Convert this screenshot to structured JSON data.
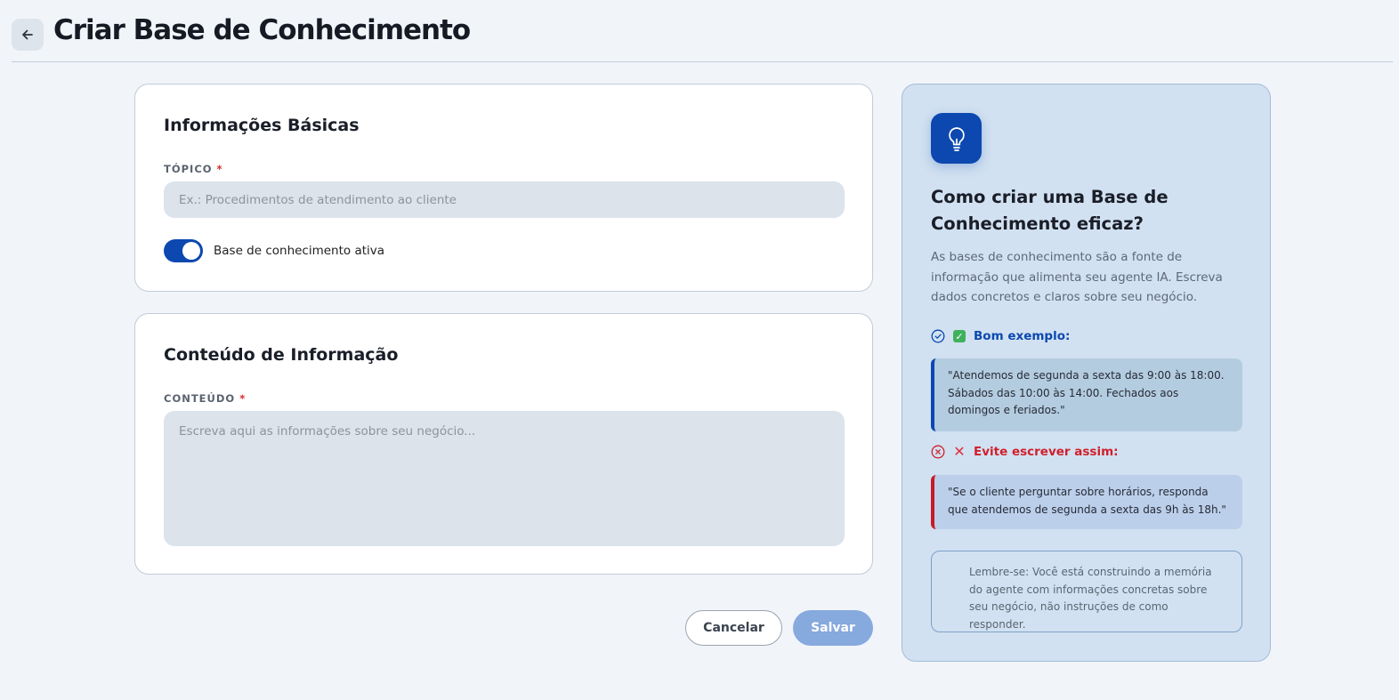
{
  "header": {
    "title": "Criar Base de Conhecimento",
    "back_icon": "arrow-left-icon"
  },
  "basic_info": {
    "title": "Informações Básicas",
    "topic_label": "TÓPICO",
    "required_mark": "*",
    "topic_value": "",
    "topic_placeholder": "Ex.: Procedimentos de atendimento ao cliente",
    "active_toggle_on": true,
    "active_label": "Base de conhecimento ativa"
  },
  "content_info": {
    "title": "Conteúdo de Informação",
    "content_label": "CONTEÚDO",
    "required_mark": "*",
    "content_value": "",
    "content_placeholder": "Escreva aqui as informações sobre seu negócio..."
  },
  "actions": {
    "cancel_label": "Cancelar",
    "save_label": "Salvar"
  },
  "tips": {
    "icon": "lightbulb-icon",
    "title": "Como criar uma Base de Conhecimento eficaz?",
    "description": "As bases de conhecimento são a fonte de informação que alimenta seu agente IA. Escreva dados concretos e claros sobre seu negócio.",
    "good_label": "Bom exemplo:",
    "good_example": "\"Atendemos de segunda a sexta das 9:00 às 18:00. Sábados das 10:00 às 14:00. Fechados aos domingos e feriados.\"",
    "bad_label": "Evite escrever assim:",
    "bad_example": "\"Se o cliente perguntar sobre horários, responda que atendemos de segunda a sexta das 9h às 18h.\"",
    "reminder": "Lembre-se: Você está construindo a memória do agente com informações concretas sobre seu negócio, não instruções de como responder."
  },
  "colors": {
    "accent": "#0c48b0",
    "background": "#f1f5fa",
    "tips_panel": "#d1e1f1",
    "error": "#d11f2b",
    "save_disabled": "#86a9de"
  }
}
